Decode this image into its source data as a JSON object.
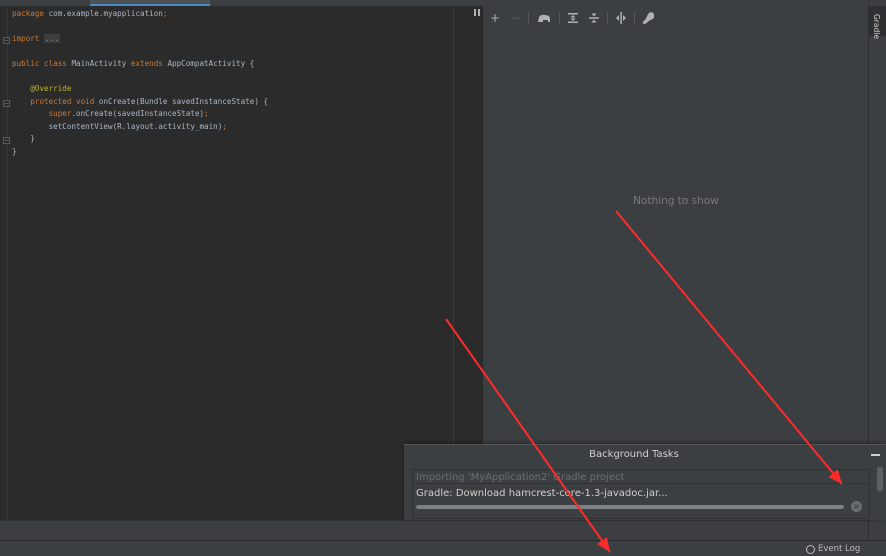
{
  "editor": {
    "lines": [
      {
        "parts": [
          {
            "t": "package ",
            "c": "kw"
          },
          {
            "t": "com.example.myapplication",
            "c": ""
          },
          {
            "t": ";",
            "c": "kw"
          }
        ]
      },
      {
        "parts": []
      },
      {
        "parts": [
          {
            "t": "import ",
            "c": "kw"
          },
          {
            "t": "...",
            "c": "fold"
          }
        ]
      },
      {
        "parts": []
      },
      {
        "parts": [
          {
            "t": "public class ",
            "c": "kw"
          },
          {
            "t": "MainActivity ",
            "c": ""
          },
          {
            "t": "extends ",
            "c": "kw"
          },
          {
            "t": "AppCompatActivity {",
            "c": ""
          }
        ]
      },
      {
        "parts": []
      },
      {
        "parts": [
          {
            "t": "    ",
            "c": ""
          },
          {
            "t": "@Override",
            "c": "an"
          }
        ]
      },
      {
        "parts": [
          {
            "t": "    ",
            "c": ""
          },
          {
            "t": "protected void ",
            "c": "kw"
          },
          {
            "t": "onCreate(Bundle savedInstanceState) {",
            "c": ""
          }
        ]
      },
      {
        "parts": [
          {
            "t": "        ",
            "c": ""
          },
          {
            "t": "super",
            "c": "kw"
          },
          {
            "t": ".onCreate(savedInstanceState)",
            "c": ""
          },
          {
            "t": ";",
            "c": "kw"
          }
        ]
      },
      {
        "parts": [
          {
            "t": "        setContentView(R.layout.",
            "c": ""
          },
          {
            "t": "activity_main",
            "c": ""
          },
          {
            "t": ")",
            "c": ""
          },
          {
            "t": ";",
            "c": "kw"
          }
        ]
      },
      {
        "parts": [
          {
            "t": "    }",
            "c": ""
          }
        ]
      },
      {
        "parts": [
          {
            "t": "}",
            "c": ""
          }
        ]
      }
    ]
  },
  "gradle": {
    "empty_text": "Nothing to show",
    "toolbar": {
      "add": "+",
      "remove": "−"
    },
    "stripe_label": "Gradle"
  },
  "background_tasks": {
    "title": "Background Tasks",
    "task_header": "Importing 'MyApplication2' Gradle project",
    "task_text": "Gradle: Download hamcrest-core-1.3-javadoc.jar...",
    "progress": 1.0
  },
  "status_bar": {
    "event_log": "Event Log"
  },
  "colors": {
    "annotation_arrow": "#ff2a2a"
  }
}
